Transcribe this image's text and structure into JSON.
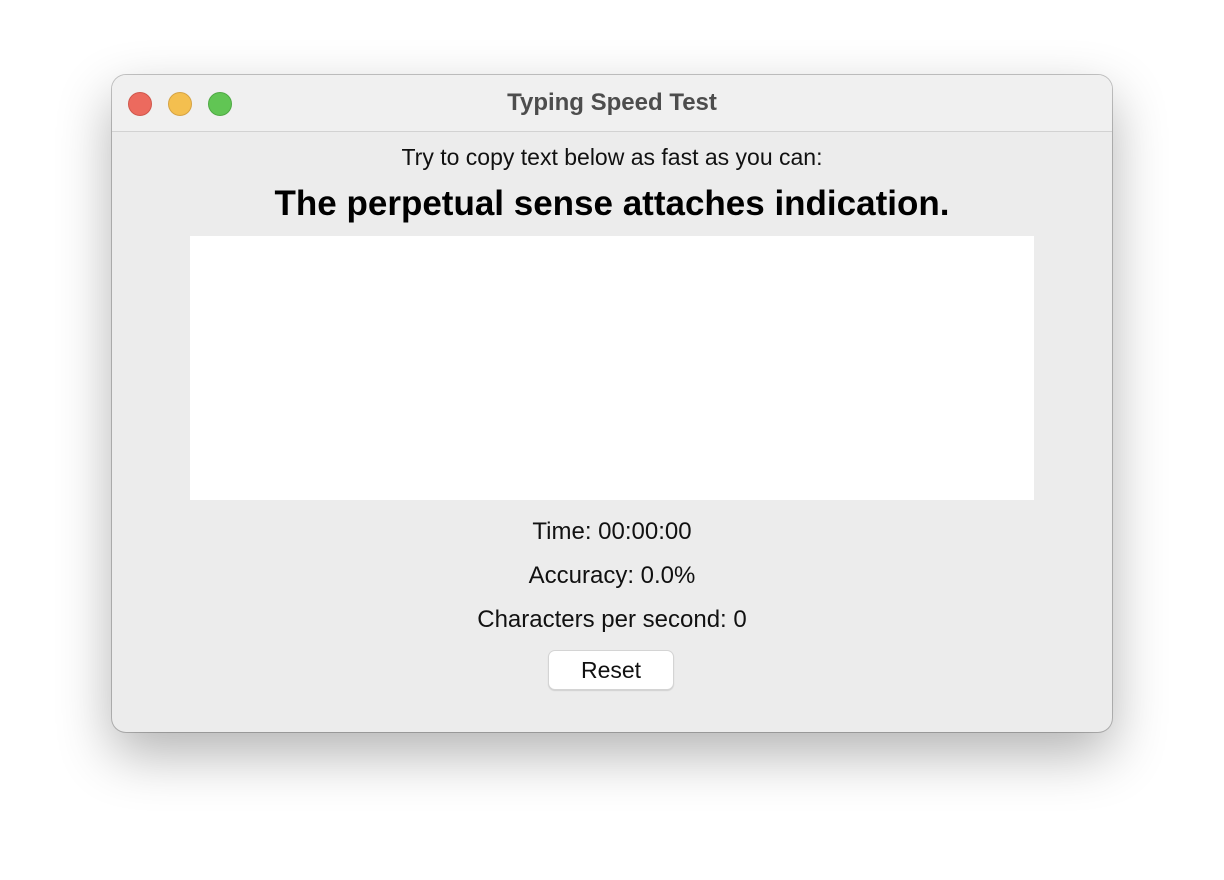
{
  "window": {
    "title": "Typing Speed Test"
  },
  "traffic_lights": {
    "close": {
      "icon": "close-icon",
      "color": "#ec6a5e"
    },
    "minimize": {
      "icon": "minimize-icon",
      "color": "#f4bf4f"
    },
    "zoom": {
      "icon": "zoom-icon",
      "color": "#61c554"
    }
  },
  "main": {
    "instruction": "Try to copy text below as fast as you can:",
    "target_text": "The perpetual sense attaches indication.",
    "input": {
      "value": "",
      "placeholder": ""
    },
    "stats": {
      "time": "Time: 00:00:00",
      "accuracy": "Accuracy: 0.0%",
      "cps": "Characters per second: 0"
    },
    "reset_label": "Reset"
  }
}
